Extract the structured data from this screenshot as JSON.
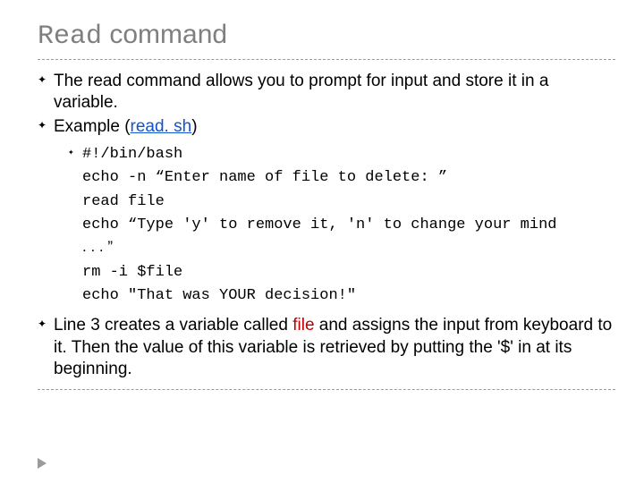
{
  "title": {
    "mono": "Read",
    "rest": " command"
  },
  "bullets": {
    "read_desc": "The read command allows you to prompt for input and store it in a variable.",
    "example_prefix": "Example (",
    "example_link": "read. sh",
    "example_suffix": ")"
  },
  "code": {
    "l1": "#!/bin/bash",
    "l2": "echo -n “Enter name of file to delete: ”",
    "l3": "read file",
    "l4": "echo “Type 'y' to remove it, 'n' to change your mind",
    "l4b": ". . . ”",
    "l5": "rm -i $file",
    "l6": "echo \"That was YOUR decision!\""
  },
  "note": {
    "pre": "Line 3 creates a variable called ",
    "kw": "file",
    "post": " and assigns the input from keyboard to it. Then the value of this variable is retrieved by putting the '$' in at its beginning."
  }
}
